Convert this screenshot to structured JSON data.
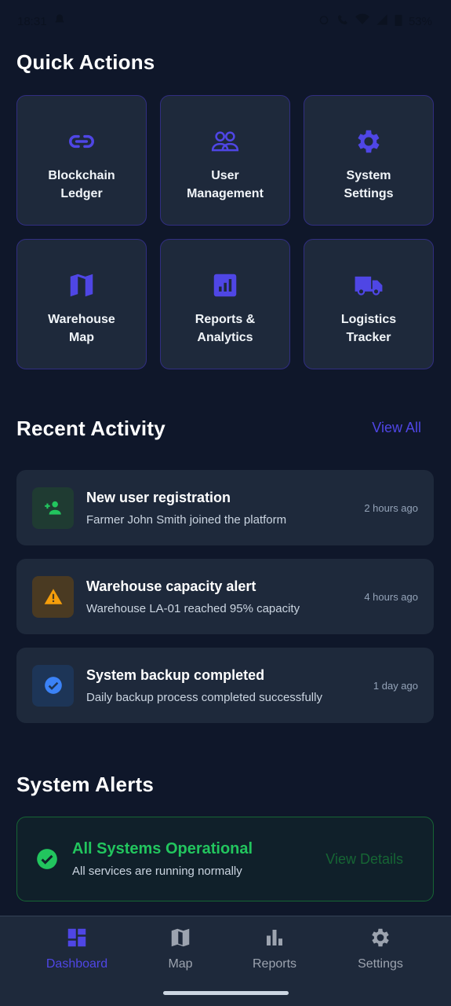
{
  "status_bar": {
    "time": "18:31",
    "battery": "53%"
  },
  "quick_actions": {
    "title": "Quick Actions",
    "items": [
      {
        "line1": "Blockchain",
        "line2": "Ledger",
        "icon": "link-icon"
      },
      {
        "line1": "User",
        "line2": "Management",
        "icon": "users-icon"
      },
      {
        "line1": "System",
        "line2": "Settings",
        "icon": "gear-icon"
      },
      {
        "line1": "Warehouse",
        "line2": "Map",
        "icon": "map-icon"
      },
      {
        "line1": "Reports &",
        "line2": "Analytics",
        "icon": "chart-icon"
      },
      {
        "line1": "Logistics",
        "line2": "Tracker",
        "icon": "truck-icon"
      }
    ]
  },
  "recent_activity": {
    "title": "Recent Activity",
    "view_all": "View All",
    "items": [
      {
        "title": "New user registration",
        "description": "Farmer John Smith joined the platform",
        "time": "2 hours ago",
        "icon": "person-add-icon",
        "color": "#22c55e"
      },
      {
        "title": "Warehouse capacity alert",
        "description": "Warehouse LA-01 reached 95% capacity",
        "time": "4 hours ago",
        "icon": "warning-icon",
        "color": "#f59e0b"
      },
      {
        "title": "System backup completed",
        "description": "Daily backup process completed successfully",
        "time": "1 day ago",
        "icon": "check-circle-icon",
        "color": "#3b82f6"
      }
    ]
  },
  "system_alerts": {
    "title": "System Alerts",
    "alert_title": "All Systems Operational",
    "alert_description": "All services are running normally",
    "view_details": "View Details"
  },
  "bottom_nav": {
    "items": [
      {
        "label": "Dashboard",
        "icon": "dashboard-icon",
        "active": true
      },
      {
        "label": "Map",
        "icon": "map-icon",
        "active": false
      },
      {
        "label": "Reports",
        "icon": "bar-chart-icon",
        "active": false
      },
      {
        "label": "Settings",
        "icon": "gear-icon",
        "active": false
      }
    ]
  },
  "colors": {
    "background": "#0f172a",
    "card": "#1e293b",
    "accent": "#4f46e5",
    "success": "#22c55e"
  }
}
